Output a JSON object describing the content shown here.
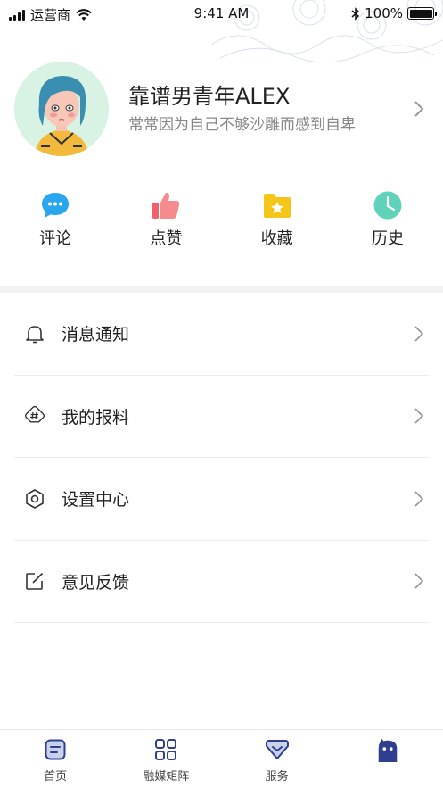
{
  "status_bar": {
    "carrier": "运营商",
    "time": "9:41 AM",
    "battery": "100%",
    "battery_level": 1.0
  },
  "profile": {
    "name": "靠谱男青年ALEX",
    "bio": "常常因为自己不够沙雕而感到自卑"
  },
  "actions": [
    {
      "label": "评论",
      "icon": "comment-bubble-icon",
      "color": "#2aa6f0"
    },
    {
      "label": "点赞",
      "icon": "thumbs-up-icon",
      "color": "#f2616b"
    },
    {
      "label": "收藏",
      "icon": "folder-star-icon",
      "color": "#f5c518"
    },
    {
      "label": "历史",
      "icon": "clock-icon",
      "color": "#5fd3b9"
    }
  ],
  "menu": [
    {
      "label": "消息通知",
      "icon": "bell-icon"
    },
    {
      "label": "我的报料",
      "icon": "hashtag-icon"
    },
    {
      "label": "设置中心",
      "icon": "settings-hexagon-icon"
    },
    {
      "label": "意见反馈",
      "icon": "edit-icon"
    }
  ],
  "tabs": [
    {
      "label": "首页",
      "icon": "home-doc-icon"
    },
    {
      "label": "融媒矩阵",
      "icon": "grid-icon"
    },
    {
      "label": "服务",
      "icon": "diamond-icon"
    },
    {
      "label": "",
      "icon": "mascot-icon",
      "active": true
    }
  ],
  "colors": {
    "text_primary": "#222222",
    "text_secondary": "#888888",
    "divider": "#f2f2f2",
    "accent_blue": "#2aa6f0",
    "accent_red": "#f2616b",
    "accent_yellow": "#f5c518",
    "accent_teal": "#5fd3b9",
    "tab_active": "#2f3e8f"
  }
}
